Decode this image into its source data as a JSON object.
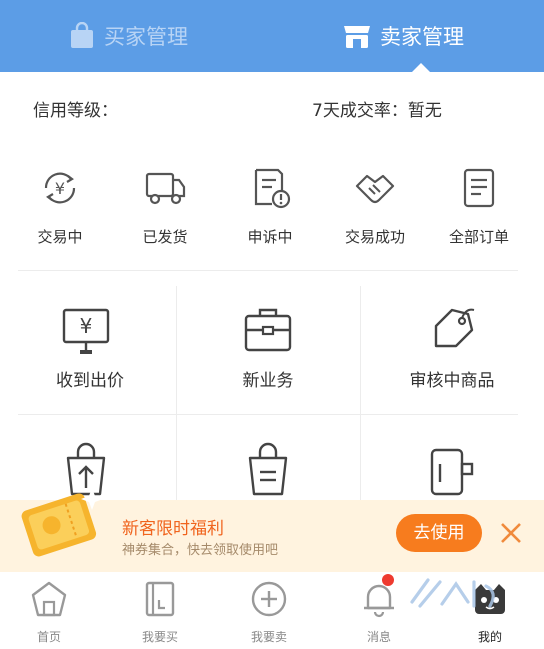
{
  "header": {
    "buyer_tab": "买家管理",
    "seller_tab": "卖家管理",
    "buyer_icon": "shopping-bag-icon",
    "seller_icon": "store-icon"
  },
  "credit": {
    "level_label": "信用等级：",
    "rate_label": "7天成交率：暂无"
  },
  "order_statuses": [
    {
      "label": "交易中",
      "icon": "yen-cycle-icon"
    },
    {
      "label": "已发货",
      "icon": "truck-icon"
    },
    {
      "label": "申诉中",
      "icon": "complaint-doc-icon"
    },
    {
      "label": "交易成功",
      "icon": "handshake-icon"
    },
    {
      "label": "全部订单",
      "icon": "order-list-icon"
    }
  ],
  "grid": [
    {
      "label": "收到出价",
      "icon": "price-board-icon"
    },
    {
      "label": "新业务",
      "icon": "briefcase-icon"
    },
    {
      "label": "审核中商品",
      "icon": "price-tag-icon"
    },
    {
      "label": "",
      "icon": "bag-upload-icon"
    },
    {
      "label": "",
      "icon": "bag-list-icon"
    },
    {
      "label": "",
      "icon": "device-icon"
    }
  ],
  "promo": {
    "title": "新客限时福利",
    "subtitle": "神券集合，快去领取使用吧",
    "button": "去使用",
    "icon": "coupon-ticket-icon"
  },
  "bottom_nav": [
    {
      "label": "首页",
      "icon": "home-icon"
    },
    {
      "label": "我要买",
      "icon": "book-icon"
    },
    {
      "label": "我要卖",
      "icon": "plus-circle-icon"
    },
    {
      "label": "消息",
      "icon": "bell-icon"
    },
    {
      "label": "我的",
      "icon": "avatar-icon"
    }
  ],
  "colors": {
    "header": "#5c9de6",
    "accent": "#f77c1e",
    "promo_bg": "#fff3df",
    "icon_gray": "#555555"
  }
}
